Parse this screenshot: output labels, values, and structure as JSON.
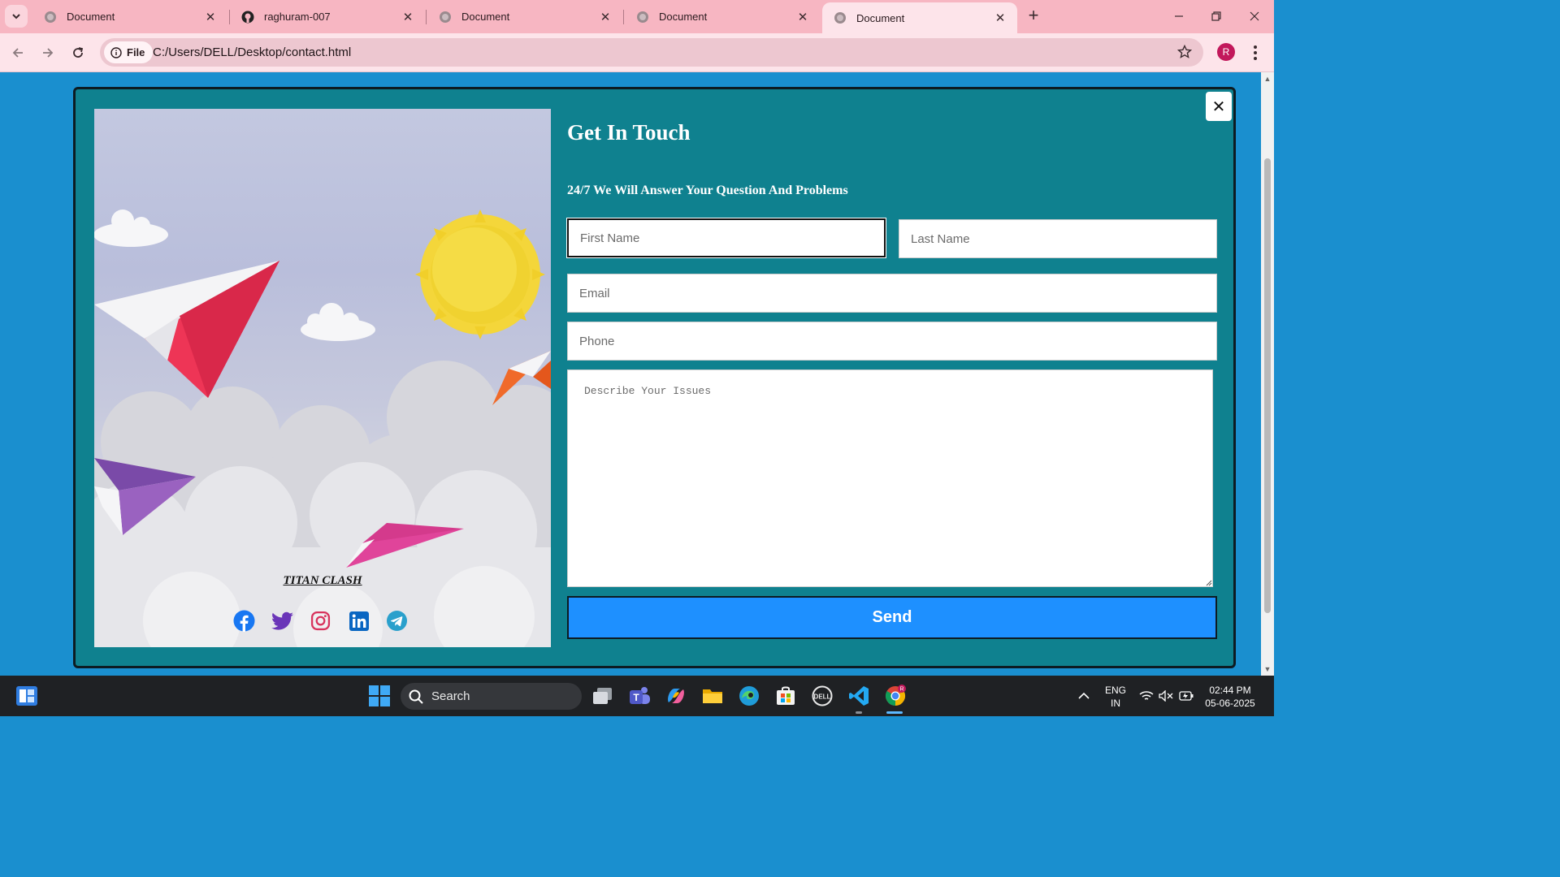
{
  "browser": {
    "tabs": [
      {
        "title": "Document",
        "icon": "globe-icon",
        "active": false
      },
      {
        "title": "raghuram-007",
        "icon": "github-icon",
        "active": false
      },
      {
        "title": "Document",
        "icon": "globe-icon",
        "active": false
      },
      {
        "title": "Document",
        "icon": "globe-icon",
        "active": false
      },
      {
        "title": "Document",
        "icon": "globe-icon",
        "active": true
      }
    ],
    "file_chip": "File",
    "url": "C:/Users/DELL/Desktop/contact.html",
    "profile_initial": "R",
    "tab_strip_color": "#f7b6c2"
  },
  "page": {
    "background_color": "#1a8fcf",
    "modal_color": "#0f818f",
    "close_symbol": "✕",
    "brand": "TITAN CLASH",
    "socials": [
      "facebook-icon",
      "twitter-icon",
      "instagram-icon",
      "linkedin-icon",
      "telegram-icon"
    ],
    "heading": "Get In Touch",
    "subheading": "24/7 We Will Answer Your Question And Problems",
    "form": {
      "first_name_placeholder": "First Name",
      "last_name_placeholder": "Last Name",
      "email_placeholder": "Email",
      "phone_placeholder": "Phone",
      "issues_placeholder": "Describe Your Issues",
      "send_label": "Send",
      "send_color": "#1e90ff"
    }
  },
  "taskbar": {
    "search_label": "Search",
    "apps": [
      "windows-start-icon",
      "task-view-icon",
      "teams-icon",
      "copilot-icon",
      "file-explorer-icon",
      "edge-icon",
      "store-icon",
      "dell-icon",
      "vscode-icon",
      "chrome-icon"
    ],
    "language": "ENG",
    "region": "IN",
    "time": "02:44 PM",
    "date": "05-06-2025"
  }
}
